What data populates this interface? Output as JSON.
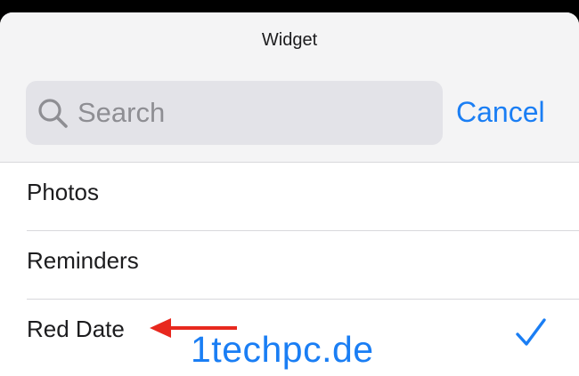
{
  "sheet": {
    "title": "Widget"
  },
  "search": {
    "placeholder": "Search",
    "value": ""
  },
  "cancel_label": "Cancel",
  "items": [
    {
      "label": "Photos",
      "selected": false
    },
    {
      "label": "Reminders",
      "selected": false
    },
    {
      "label": "Red Date",
      "selected": true
    }
  ],
  "watermark": "1techpc.de",
  "colors": {
    "accent": "#1a7ef4",
    "arrow": "#e8281e"
  }
}
